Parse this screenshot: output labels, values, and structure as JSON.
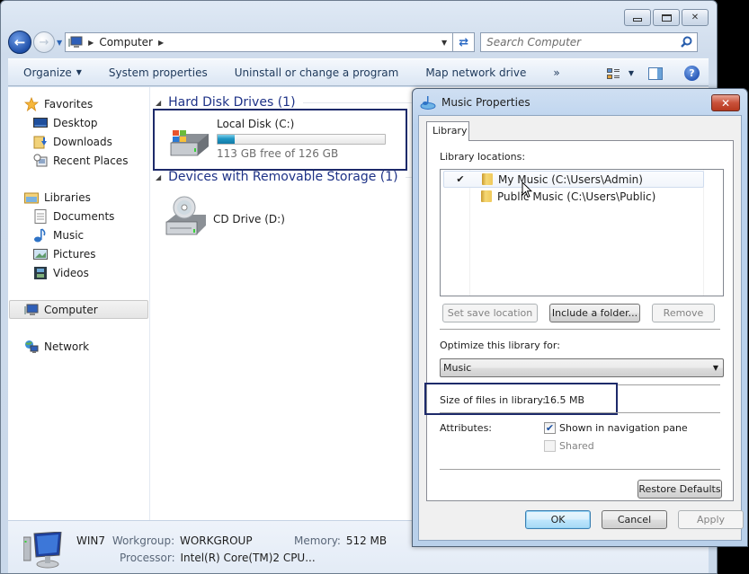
{
  "explorer": {
    "caption_buttons": {
      "minimize": "minimize",
      "maximize": "maximize",
      "close": "✕"
    },
    "address": {
      "crumbs": [
        "Computer"
      ]
    },
    "search": {
      "placeholder": "Search Computer"
    },
    "toolbar": {
      "items": [
        "Organize",
        "System properties",
        "Uninstall or change a program",
        "Map network drive"
      ],
      "more": "»"
    },
    "nav": {
      "favorites": {
        "label": "Favorites",
        "items": [
          "Desktop",
          "Downloads",
          "Recent Places"
        ]
      },
      "libraries": {
        "label": "Libraries",
        "items": [
          "Documents",
          "Music",
          "Pictures",
          "Videos"
        ]
      },
      "computer": {
        "label": "Computer"
      },
      "network": {
        "label": "Network"
      }
    },
    "groups": {
      "hdd": {
        "title": "Hard Disk Drives (1)"
      },
      "removable": {
        "title": "Devices with Removable Storage (1)"
      }
    },
    "drives": {
      "c": {
        "name": "Local Disk (C:)",
        "free_text": "113 GB free of 126 GB",
        "used_fraction": 0.103
      },
      "d": {
        "name": "CD Drive (D:)"
      }
    },
    "details": {
      "computer_name": "WIN7",
      "workgroup_label": "Workgroup:",
      "workgroup": "WORKGROUP",
      "memory_label": "Memory:",
      "memory": "512 MB",
      "processor_label": "Processor:",
      "processor": "Intel(R) Core(TM)2 CPU..."
    }
  },
  "dialog": {
    "title": "Music Properties",
    "close": "✕",
    "tab": "Library",
    "locations_label": "Library locations:",
    "locations": [
      {
        "check": "✔",
        "label": "My Music (C:\\Users\\Admin)"
      },
      {
        "check": "",
        "label": "Public Music (C:\\Users\\Public)"
      }
    ],
    "buttons": {
      "set_save": "Set save location",
      "include": "Include a folder...",
      "remove": "Remove",
      "restore": "Restore Defaults",
      "ok": "OK",
      "cancel": "Cancel",
      "apply": "Apply"
    },
    "optimize_label": "Optimize this library for:",
    "optimize_value": "Music",
    "size_label": "Size of files in library:",
    "size_value": "16.5 MB",
    "attributes_label": "Attributes:",
    "attr_shown": {
      "label": "Shown in navigation pane",
      "checked": true
    },
    "attr_shared": {
      "label": "Shared",
      "checked": false
    }
  }
}
